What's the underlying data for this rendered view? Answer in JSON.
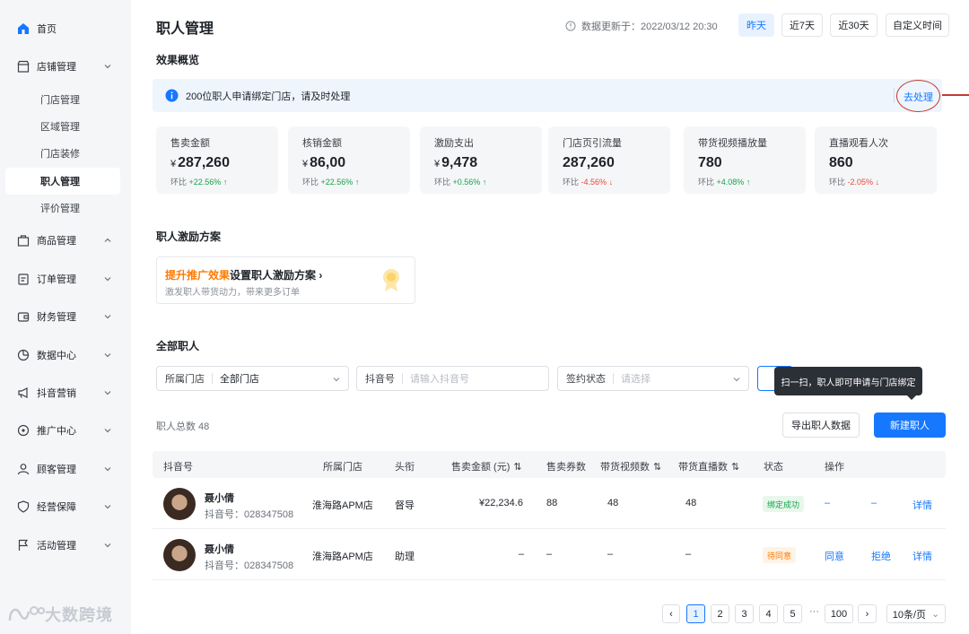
{
  "sidebar": {
    "items": [
      {
        "label": "首页",
        "icon": "home-icon"
      },
      {
        "label": "店铺管理",
        "icon": "store-icon"
      },
      {
        "label": "商品管理",
        "icon": "goods-icon"
      },
      {
        "label": "订单管理",
        "icon": "order-icon"
      },
      {
        "label": "财务管理",
        "icon": "wallet-icon"
      },
      {
        "label": "数据中心",
        "icon": "chart-icon"
      },
      {
        "label": "抖音营销",
        "icon": "megaphone-icon"
      },
      {
        "label": "推广中心",
        "icon": "location-icon"
      },
      {
        "label": "顾客管理",
        "icon": "user-icon"
      },
      {
        "label": "经营保障",
        "icon": "shield-icon"
      },
      {
        "label": "活动管理",
        "icon": "flag-icon"
      }
    ],
    "store_sub": [
      "门店管理",
      "区域管理",
      "门店装修",
      "职人管理",
      "评价管理"
    ]
  },
  "watermark": "大数跨境",
  "header": {
    "title": "职人管理",
    "update_text": "数据更新于：2022/03/12 20:30",
    "ranges": [
      "昨天",
      "近7天",
      "近30天",
      "自定义时间"
    ]
  },
  "overview": {
    "title": "效果概览",
    "notice": "200位职人申请绑定门店，请及时处理",
    "notice_link": "去处理",
    "cmp_label": "环比",
    "metrics": [
      {
        "label": "售卖金额",
        "cur": "¥",
        "value": "287,260",
        "change": "+22.56%",
        "dir": "up"
      },
      {
        "label": "核销金额",
        "cur": "¥",
        "value": "86,00",
        "change": "+22.56%",
        "dir": "up"
      },
      {
        "label": "激励支出",
        "cur": "¥",
        "value": "9,478",
        "change": "+0.56%",
        "dir": "up"
      },
      {
        "label": "门店页引流量",
        "cur": "",
        "value": "287,260",
        "change": "-4.56%",
        "dir": "down"
      },
      {
        "label": "带货视频播放量",
        "cur": "",
        "value": "780",
        "change": "+4.08%",
        "dir": "up"
      },
      {
        "label": "直播观看人次",
        "cur": "",
        "value": "860",
        "change": "-2.05%",
        "dir": "down"
      }
    ]
  },
  "incentive": {
    "title": "职人激励方案",
    "highlight": "提升推广效果",
    "rest": "设置职人激励方案",
    "sub": "激发职人带货动力，带来更多订单"
  },
  "staff": {
    "title": "全部职人",
    "filters": {
      "store_label": "所属门店",
      "store_value": "全部门店",
      "douyin_label": "抖音号",
      "douyin_placeholder": "请输入抖音号",
      "sign_label": "签约状态",
      "sign_placeholder": "请选择"
    },
    "tooltip": "扫一扫，职人即可申请与门店绑定",
    "total": "职人总数 48",
    "export_label": "导出职人数据",
    "new_label": "新建职人",
    "columns": [
      "抖音号",
      "所属门店",
      "头衔",
      "售卖金额 (元)",
      "售卖券数",
      "带货视频数",
      "带货直播数",
      "状态",
      "操作"
    ],
    "rows": [
      {
        "name": "聂小倩",
        "uid": "抖音号：028347508",
        "store": "淮海路APM店",
        "title": "督导",
        "amount": "¥22,234.6",
        "coupons": "88",
        "videos": "48",
        "lives": "48",
        "status": "绑定成功",
        "status_type": "ok",
        "op1": "–",
        "op2": "–",
        "op3": "详情"
      },
      {
        "name": "聂小倩",
        "uid": "抖音号：028347508",
        "store": "淮海路APM店",
        "title": "助理",
        "amount": "–",
        "coupons": "–",
        "videos": "–",
        "lives": "–",
        "status": "待同意",
        "status_type": "wait",
        "op1": "同意",
        "op2": "拒绝",
        "op3": "详情"
      }
    ]
  },
  "pagination": {
    "pages": [
      "1",
      "2",
      "3",
      "4",
      "5"
    ],
    "ellipsis": "···",
    "last": "100",
    "size": "10条/页"
  },
  "colors": {
    "accent": "#1677ff",
    "up": "#16a34a",
    "down": "#e5483b",
    "warn": "#ff7a00"
  }
}
